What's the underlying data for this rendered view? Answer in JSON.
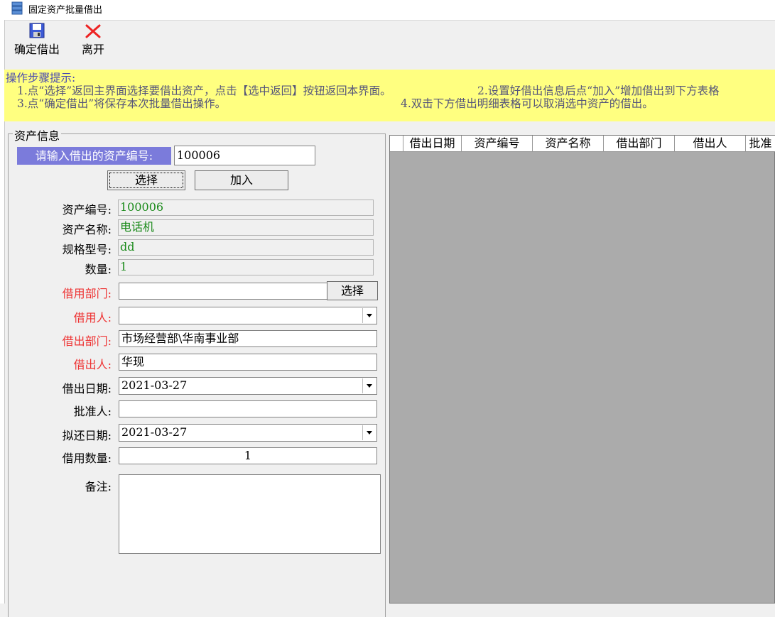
{
  "window": {
    "title": "固定资产批量借出"
  },
  "toolbar": {
    "confirm_label": "确定借出",
    "exit_label": "离开"
  },
  "tips": {
    "heading": "操作步骤提示:",
    "line1a": "1.点“选择”返回主界面选择要借出资产，点击【选中返回】按钮返回本界面。",
    "line1b": "2.设置好借出信息后点“加入”增加借出到下方表格",
    "line2a": "3.点“确定借出”将保存本次批量借出操作。",
    "line2b": "4.双击下方借出明细表格可以取消选中资产的借出。"
  },
  "group": {
    "title": "资产信息"
  },
  "asset_input": {
    "prompt": "请输入借出的资产编号:",
    "value": "100006",
    "select_label": "选择",
    "add_label": "加入"
  },
  "fields": {
    "asset_no": {
      "label": "资产编号:",
      "value": "100006"
    },
    "asset_name": {
      "label": "资产名称:",
      "value": "电话机"
    },
    "spec": {
      "label": "规格型号:",
      "value": "dd"
    },
    "quantity": {
      "label": "数量:",
      "value": "1"
    },
    "borrow_dept": {
      "label": "借用部门:",
      "value": "",
      "button": "选择"
    },
    "borrower": {
      "label": "借用人:",
      "value": ""
    },
    "lend_dept": {
      "label": "借出部门:",
      "value": "市场经营部\\华南事业部"
    },
    "lender": {
      "label": "借出人:",
      "value": "华现"
    },
    "lend_date": {
      "label": "借出日期:",
      "value": "2021-03-27"
    },
    "approver": {
      "label": "批准人:",
      "value": ""
    },
    "return_date": {
      "label": "拟还日期:",
      "value": "2021-03-27"
    },
    "borrow_qty": {
      "label": "借用数量:",
      "value": "1"
    },
    "remark": {
      "label": "备注:",
      "value": ""
    }
  },
  "table": {
    "columns": [
      "借出日期",
      "资产编号",
      "资产名称",
      "借出部门",
      "借出人",
      "批准"
    ]
  },
  "colors": {
    "tips_bg": "#ffff80",
    "prompt_bg": "#7b7bdb",
    "required_label": "#e33333",
    "readonly_value": "#1a8a1a",
    "grid_bg": "#ababab"
  }
}
